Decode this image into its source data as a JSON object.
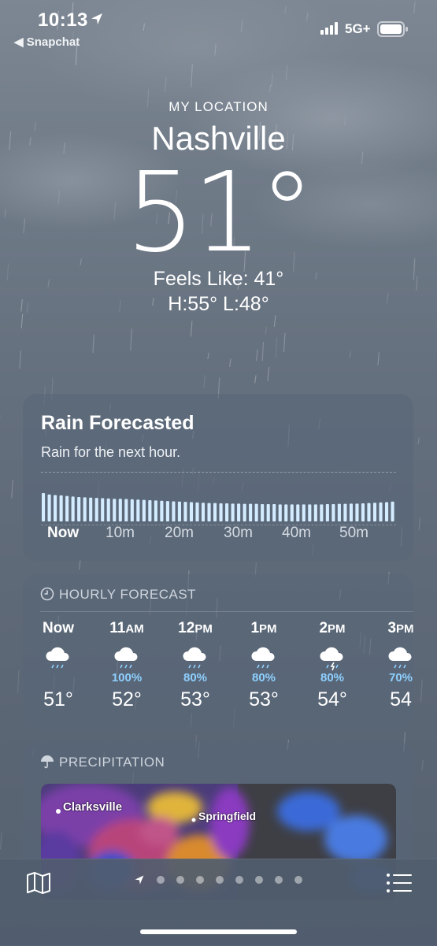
{
  "status": {
    "time": "10:13",
    "back_app": "◀ Snapchat",
    "network": "5G+"
  },
  "hero": {
    "label": "MY LOCATION",
    "city": "Nashville",
    "temp": "51°",
    "feels_like": "Feels Like: 41°",
    "hi_lo": "H:55°  L:48°"
  },
  "rain_card": {
    "title": "Rain Forecasted",
    "subtitle": "Rain for the next hour.",
    "ticks": [
      "Now",
      "10m",
      "20m",
      "30m",
      "40m",
      "50m"
    ],
    "intensity": [
      1.0,
      0.95,
      0.93,
      0.92,
      0.9,
      0.88,
      0.86,
      0.85,
      0.84,
      0.83,
      0.82,
      0.81,
      0.8,
      0.8,
      0.79,
      0.78,
      0.77,
      0.76,
      0.75,
      0.74,
      0.73,
      0.72,
      0.71,
      0.7,
      0.69,
      0.68,
      0.67,
      0.66,
      0.65,
      0.65,
      0.64,
      0.64,
      0.63,
      0.63,
      0.62,
      0.62,
      0.62,
      0.61,
      0.61,
      0.61,
      0.6,
      0.6,
      0.6,
      0.6,
      0.6,
      0.6,
      0.6,
      0.6,
      0.61,
      0.61,
      0.62,
      0.62,
      0.63,
      0.63,
      0.64,
      0.65,
      0.66,
      0.67,
      0.68,
      0.7
    ]
  },
  "hourly": {
    "header": "HOURLY FORECAST",
    "items": [
      {
        "hour": "Now",
        "suffix": "",
        "icon": "cloud-rain-icon",
        "pct": "",
        "temp": "51°"
      },
      {
        "hour": "11",
        "suffix": "AM",
        "icon": "cloud-rain-icon",
        "pct": "100%",
        "temp": "52°"
      },
      {
        "hour": "12",
        "suffix": "PM",
        "icon": "cloud-rain-icon",
        "pct": "80%",
        "temp": "53°"
      },
      {
        "hour": "1",
        "suffix": "PM",
        "icon": "cloud-rain-icon",
        "pct": "80%",
        "temp": "53°"
      },
      {
        "hour": "2",
        "suffix": "PM",
        "icon": "cloud-bolt-rain-icon",
        "pct": "80%",
        "temp": "54°"
      },
      {
        "hour": "3",
        "suffix": "PM",
        "icon": "cloud-rain-icon",
        "pct": "70%",
        "temp": "54"
      }
    ]
  },
  "precip": {
    "header": "PRECIPITATION",
    "places": [
      "Clarksville",
      "Springfield"
    ]
  },
  "colors": {
    "accent_blue": "#8ed0ff",
    "card_bg": "#586678",
    "bar_fill": "#d4ecff"
  }
}
